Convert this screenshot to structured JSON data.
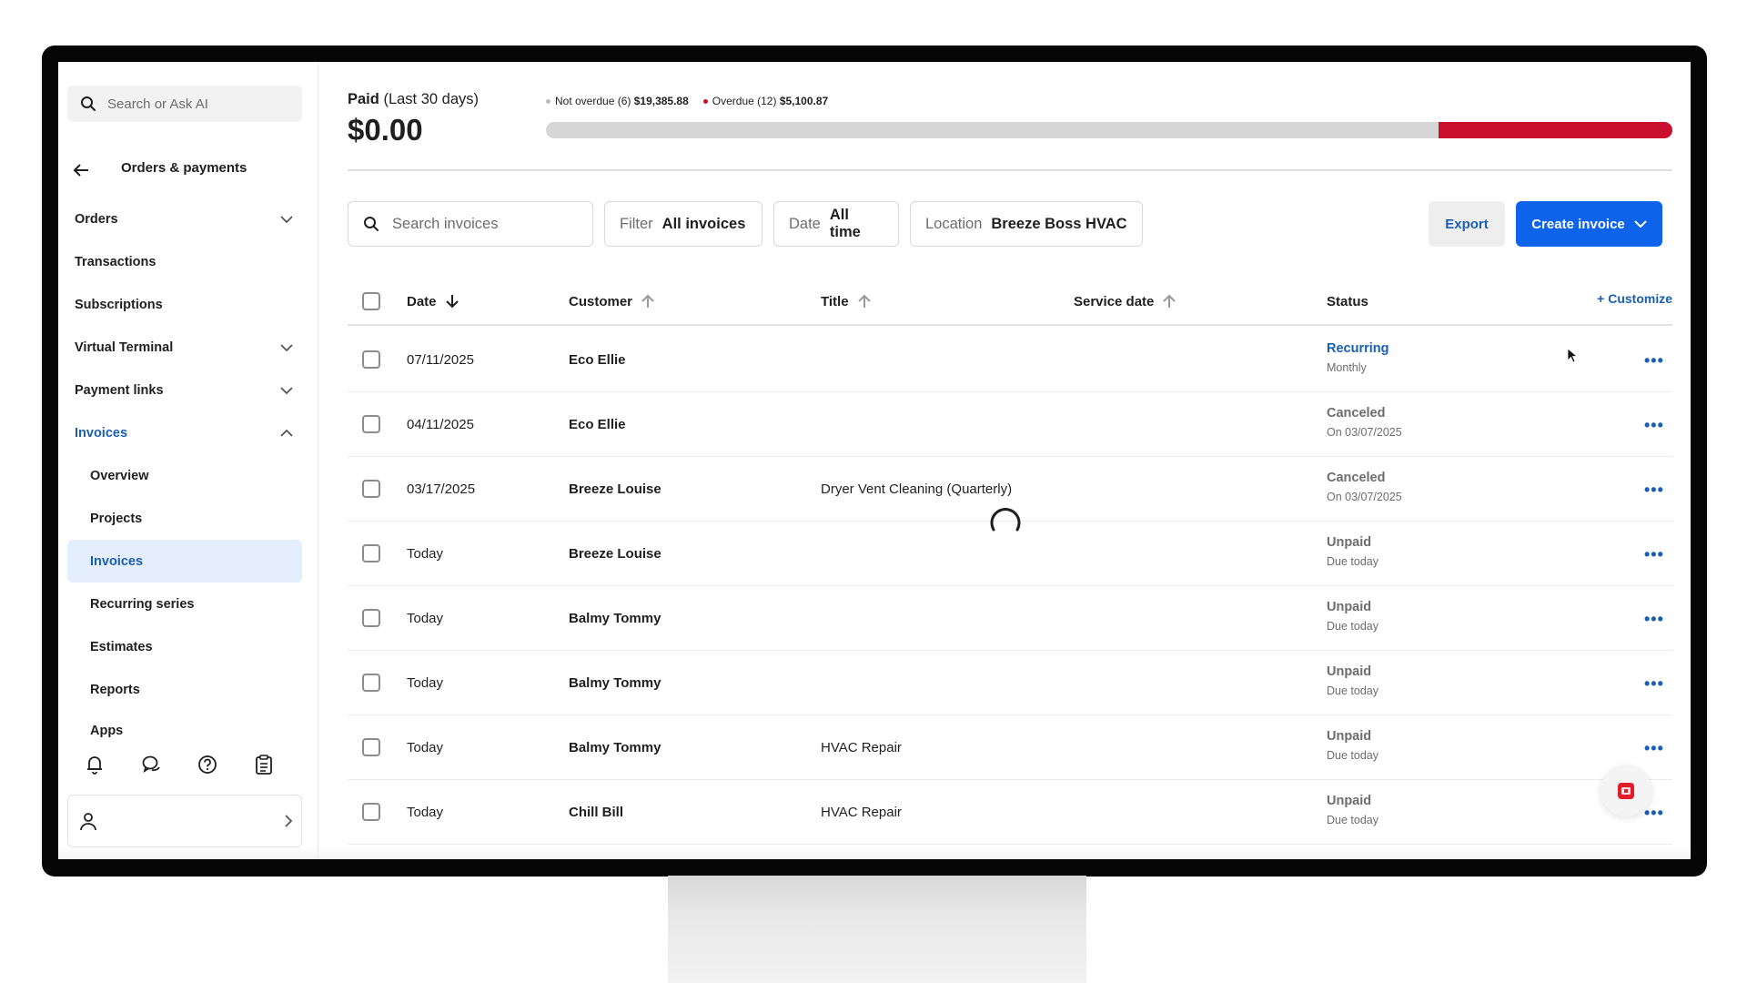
{
  "sidebar": {
    "search_placeholder": "Search or Ask AI",
    "heading": "Orders & payments",
    "items": [
      {
        "label": "Orders",
        "chevron": "down"
      },
      {
        "label": "Transactions",
        "chevron": ""
      },
      {
        "label": "Subscriptions",
        "chevron": ""
      },
      {
        "label": "Virtual Terminal",
        "chevron": "down"
      },
      {
        "label": "Payment links",
        "chevron": "down"
      },
      {
        "label": "Invoices",
        "chevron": "up"
      },
      {
        "label": "Overview"
      },
      {
        "label": "Projects"
      },
      {
        "label": "Invoices"
      },
      {
        "label": "Recurring series"
      },
      {
        "label": "Estimates"
      },
      {
        "label": "Reports"
      },
      {
        "label": "Apps"
      }
    ],
    "bottom_icons": [
      "bell-icon",
      "chat-icon",
      "help-icon",
      "clipboard-icon"
    ]
  },
  "summary": {
    "paid_label": "Paid",
    "paid_period": "(Last 30 days)",
    "paid_amount": "$0.00",
    "not_overdue_label": "Not overdue (6)",
    "not_overdue_amount": "$19,385.88",
    "overdue_label": "Overdue (12)",
    "overdue_amount": "$5,100.87",
    "overdue_fraction": 0.208,
    "colors": {
      "not_overdue": "#d6d6d6",
      "overdue": "#c8102e"
    }
  },
  "toolbar": {
    "search_placeholder": "Search invoices",
    "filter_key": "Filter",
    "filter_value": "All invoices",
    "date_key": "Date",
    "date_value": "All time",
    "location_key": "Location",
    "location_value": "Breeze Boss HVAC",
    "export_label": "Export",
    "create_label": "Create invoice"
  },
  "table": {
    "headers": {
      "date": "Date",
      "customer": "Customer",
      "title": "Title",
      "service_date": "Service date",
      "status": "Status",
      "customize": "+ Customize"
    },
    "rows": [
      {
        "date": "07/11/2025",
        "customer": "Eco Ellie",
        "title": "",
        "status": "Recurring",
        "status_detail": "Monthly"
      },
      {
        "date": "04/11/2025",
        "customer": "Eco Ellie",
        "title": "",
        "status": "Canceled",
        "status_detail": "On 03/07/2025"
      },
      {
        "date": "03/17/2025",
        "customer": "Breeze Louise",
        "title": "Dryer Vent Cleaning (Quarterly)",
        "status": "Canceled",
        "status_detail": "On 03/07/2025"
      },
      {
        "date": "Today",
        "customer": "Breeze Louise",
        "title": "",
        "status": "Unpaid",
        "status_detail": "Due today"
      },
      {
        "date": "Today",
        "customer": "Balmy Tommy",
        "title": "",
        "status": "Unpaid",
        "status_detail": "Due today"
      },
      {
        "date": "Today",
        "customer": "Balmy Tommy",
        "title": "",
        "status": "Unpaid",
        "status_detail": "Due today"
      },
      {
        "date": "Today",
        "customer": "Balmy Tommy",
        "title": "HVAC Repair",
        "status": "Unpaid",
        "status_detail": "Due today"
      },
      {
        "date": "Today",
        "customer": "Chill Bill",
        "title": "HVAC Repair",
        "status": "Unpaid",
        "status_detail": "Due today"
      }
    ],
    "more_glyph": "•••"
  },
  "colors": {
    "accent": "#1a5fb4",
    "primary_button": "#0d63ea",
    "selected_bg": "#e4eefc"
  }
}
